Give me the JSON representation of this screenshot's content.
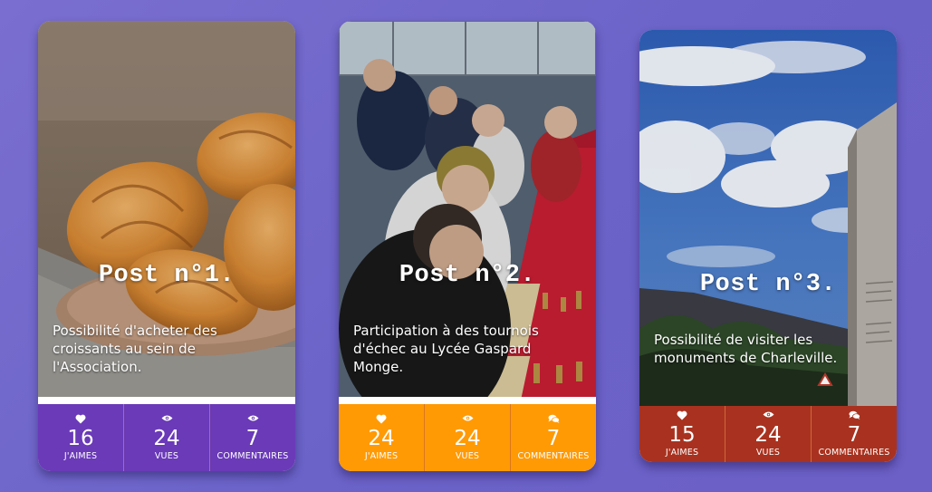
{
  "posts": [
    {
      "title": "Post n°1.",
      "description": "Possibilité d'acheter des croissants au sein de l'Association.",
      "image": "croissants-photo",
      "accent": "#6a3ab8",
      "stats": {
        "likes": {
          "icon": "heart-icon",
          "value": "16",
          "label": "J'AIMES"
        },
        "views": {
          "icon": "eye-icon",
          "value": "24",
          "label": "VUES"
        },
        "comments": {
          "icon": "eye-icon",
          "value": "7",
          "label": "COMMENTAIRES"
        }
      }
    },
    {
      "title": "Post n°2.",
      "description": "Participation à des tournois d'échec au Lycée Gaspard Monge.",
      "image": "chess-tournament-photo",
      "accent": "#ff9a05",
      "stats": {
        "likes": {
          "icon": "heart-icon",
          "value": "24",
          "label": "J'AIMES"
        },
        "views": {
          "icon": "eye-icon",
          "value": "24",
          "label": "VUES"
        },
        "comments": {
          "icon": "comments-icon",
          "value": "7",
          "label": "COMMENTAIRES"
        }
      }
    },
    {
      "title": "Post n°3.",
      "description": "Possibilité de visiter les monuments de Charleville.",
      "image": "charleville-sky-photo",
      "accent": "#a8321f",
      "stats": {
        "likes": {
          "icon": "heart-icon",
          "value": "15",
          "label": "J'AIMES"
        },
        "views": {
          "icon": "eye-icon",
          "value": "24",
          "label": "VUES"
        },
        "comments": {
          "icon": "comments-icon",
          "value": "7",
          "label": "COMMENTAIRES"
        }
      }
    }
  ]
}
